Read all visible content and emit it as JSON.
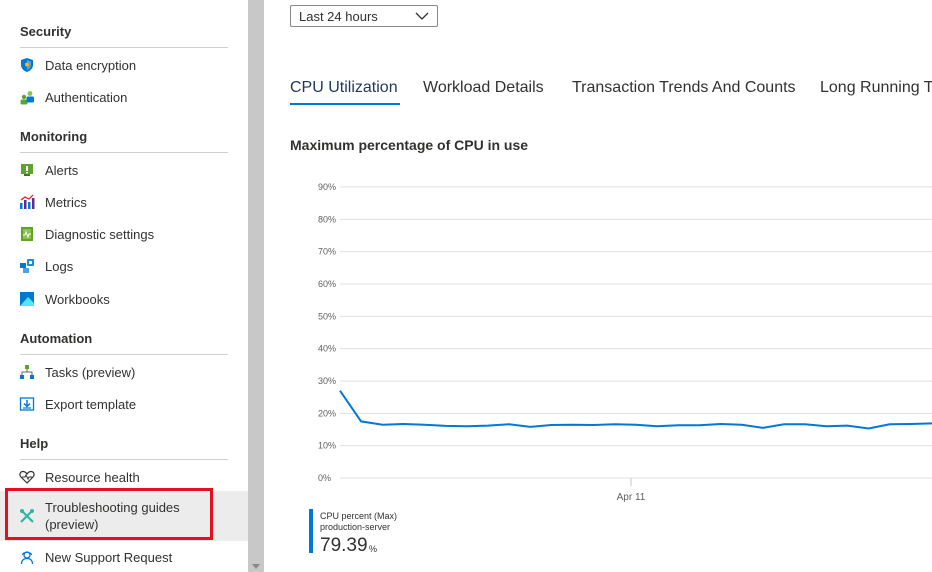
{
  "sidebar": {
    "sections": [
      {
        "title": "Security",
        "items": [
          {
            "label": "Data encryption",
            "icon": "shield-icon"
          },
          {
            "label": "Authentication",
            "icon": "users-icon"
          }
        ]
      },
      {
        "title": "Monitoring",
        "items": [
          {
            "label": "Alerts",
            "icon": "alert-icon"
          },
          {
            "label": "Metrics",
            "icon": "metrics-icon"
          },
          {
            "label": "Diagnostic settings",
            "icon": "diagnostic-icon"
          },
          {
            "label": "Logs",
            "icon": "logs-icon"
          },
          {
            "label": "Workbooks",
            "icon": "workbooks-icon"
          }
        ]
      },
      {
        "title": "Automation",
        "items": [
          {
            "label": "Tasks (preview)",
            "icon": "tasks-icon"
          },
          {
            "label": "Export template",
            "icon": "export-icon"
          }
        ]
      },
      {
        "title": "Help",
        "items": [
          {
            "label": "Resource health",
            "icon": "heart-icon"
          },
          {
            "label": "Troubleshooting guides (preview)",
            "icon": "wrench-icon",
            "selected": true,
            "highlighted": true
          },
          {
            "label": "New Support Request",
            "icon": "support-icon"
          }
        ]
      }
    ]
  },
  "main": {
    "time_range": "Last 24 hours",
    "tabs": [
      {
        "label": "CPU Utilization",
        "active": true
      },
      {
        "label": "Workload Details"
      },
      {
        "label": "Transaction Trends And Counts"
      },
      {
        "label": "Long Running T"
      }
    ],
    "chart_title": "Maximum percentage of CPU in use",
    "legend": {
      "series": "CPU percent (Max)",
      "resource": "production-server",
      "value": "79.39",
      "unit": "%"
    }
  },
  "colors": {
    "accent": "#0078d4",
    "highlight": "#e3101f",
    "selected_bg": "#ececec",
    "splitter": "#c8c8c8"
  },
  "chart_data": {
    "type": "line",
    "yticks": [
      "90%",
      "80%",
      "70%",
      "60%",
      "50%",
      "40%",
      "30%",
      "20%",
      "10%",
      "0%"
    ],
    "ylim": [
      0,
      90
    ],
    "xtick": "Apr 11",
    "grid": true,
    "series": [
      {
        "name": "CPU percent (Max)",
        "color": "#0078d4",
        "values": [
          27,
          17.5,
          16.5,
          16.7,
          16.5,
          16.1,
          16.0,
          16.2,
          16.6,
          15.8,
          16.4,
          16.5,
          16.4,
          16.6,
          16.5,
          16.0,
          16.3,
          16.3,
          16.7,
          16.5,
          15.5,
          16.6,
          16.6,
          16.0,
          16.2,
          15.3,
          16.6,
          16.7,
          16.9
        ]
      }
    ]
  }
}
